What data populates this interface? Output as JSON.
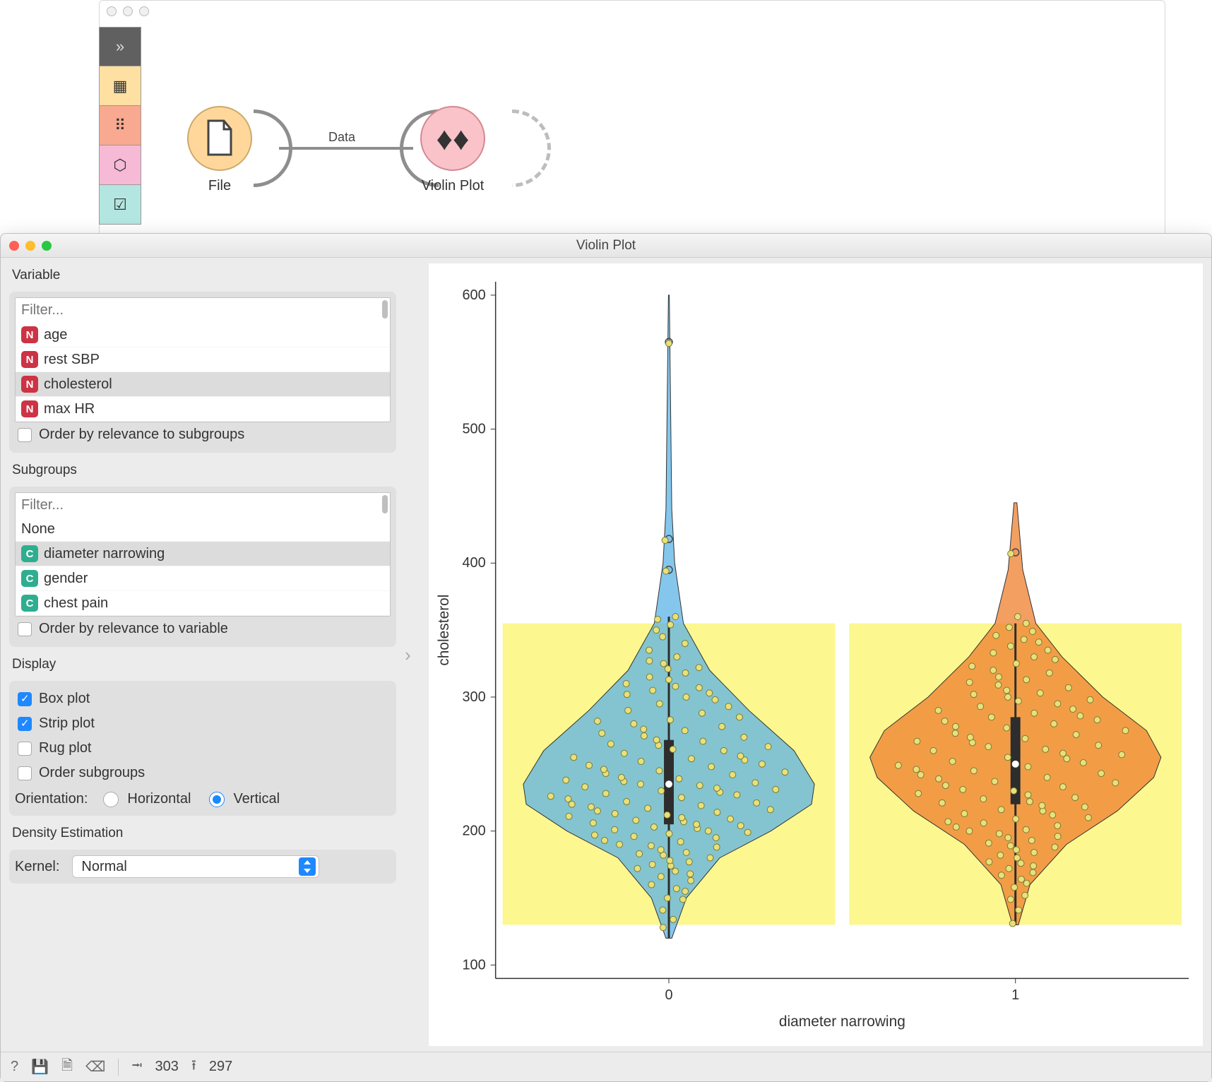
{
  "canvas": {
    "file_label": "File",
    "violin_label": "Violin Plot",
    "link_label": "Data"
  },
  "dialog": {
    "title": "Violin Plot",
    "variable_header": "Variable",
    "filter_placeholder": "Filter...",
    "variables": [
      {
        "badge": "N",
        "name": "age",
        "selected": false
      },
      {
        "badge": "N",
        "name": "rest SBP",
        "selected": false
      },
      {
        "badge": "N",
        "name": "cholesterol",
        "selected": true
      },
      {
        "badge": "N",
        "name": "max HR",
        "selected": false
      }
    ],
    "var_order_label": "Order by relevance to subgroups",
    "var_order_checked": false,
    "subgroups_header": "Subgroups",
    "subgroups": [
      {
        "badge": "",
        "name": "None",
        "selected": false
      },
      {
        "badge": "C",
        "name": "diameter narrowing",
        "selected": true
      },
      {
        "badge": "C",
        "name": "gender",
        "selected": false
      },
      {
        "badge": "C",
        "name": "chest pain",
        "selected": false
      }
    ],
    "sub_order_label": "Order by relevance to variable",
    "sub_order_checked": false,
    "display_header": "Display",
    "display_opts": [
      {
        "label": "Box plot",
        "checked": true
      },
      {
        "label": "Strip plot",
        "checked": true
      },
      {
        "label": "Rug plot",
        "checked": false
      },
      {
        "label": "Order subgroups",
        "checked": false
      }
    ],
    "orientation_label": "Orientation:",
    "orient_horizontal": "Horizontal",
    "orient_vertical": "Vertical",
    "orient_value": "Vertical",
    "density_header": "Density Estimation",
    "kernel_label": "Kernel:",
    "kernel_value": "Normal"
  },
  "status": {
    "in_count": "303",
    "out_count": "297"
  },
  "chart_data": {
    "type": "violin",
    "xlabel": "diameter narrowing",
    "ylabel": "cholesterol",
    "ytick": [
      100,
      200,
      300,
      400,
      500,
      600
    ],
    "ylim": [
      90,
      610
    ],
    "categories": [
      "0",
      "1"
    ],
    "selection_band": [
      130,
      355
    ],
    "series": [
      {
        "name": "0",
        "color": "#5cb3e6",
        "median": 235,
        "q1": 205,
        "q3": 268,
        "whisker_low": 120,
        "whisker_high": 360,
        "outliers": [
          395,
          418,
          565
        ],
        "violin_widths": [
          [
            120,
            0.02
          ],
          [
            150,
            0.12
          ],
          [
            180,
            0.35
          ],
          [
            200,
            0.7
          ],
          [
            220,
            0.98
          ],
          [
            235,
            1.0
          ],
          [
            260,
            0.86
          ],
          [
            290,
            0.55
          ],
          [
            320,
            0.28
          ],
          [
            355,
            0.1
          ],
          [
            400,
            0.04
          ],
          [
            440,
            0.02
          ],
          [
            600,
            0.003
          ]
        ]
      },
      {
        "name": "1",
        "color": "#ef7f2e",
        "median": 250,
        "q1": 220,
        "q3": 285,
        "whisker_low": 130,
        "whisker_high": 355,
        "outliers": [
          408
        ],
        "violin_widths": [
          [
            130,
            0.02
          ],
          [
            160,
            0.1
          ],
          [
            190,
            0.35
          ],
          [
            215,
            0.7
          ],
          [
            240,
            0.95
          ],
          [
            255,
            1.0
          ],
          [
            275,
            0.9
          ],
          [
            300,
            0.6
          ],
          [
            330,
            0.32
          ],
          [
            355,
            0.14
          ],
          [
            395,
            0.05
          ],
          [
            445,
            0.01
          ]
        ]
      }
    ],
    "strip_points": {
      "0": [
        128,
        134,
        141,
        149,
        150,
        155,
        157,
        160,
        163,
        166,
        168,
        170,
        172,
        174,
        175,
        177,
        178,
        180,
        182,
        183,
        184,
        186,
        188,
        189,
        190,
        192,
        193,
        195,
        196,
        197,
        198,
        199,
        200,
        201,
        202,
        203,
        204,
        205,
        206,
        207,
        208,
        209,
        210,
        211,
        212,
        213,
        214,
        215,
        216,
        217,
        218,
        219,
        220,
        221,
        222,
        224,
        225,
        226,
        227,
        228,
        229,
        230,
        231,
        232,
        233,
        234,
        235,
        236,
        237,
        238,
        239,
        240,
        242,
        243,
        244,
        245,
        246,
        248,
        249,
        250,
        252,
        253,
        254,
        255,
        256,
        258,
        260,
        261,
        263,
        264,
        265,
        267,
        268,
        270,
        271,
        273,
        275,
        276,
        278,
        280,
        282,
        283,
        285,
        288,
        290,
        293,
        295,
        298,
        300,
        302,
        303,
        305,
        307,
        308,
        310,
        313,
        315,
        318,
        321,
        322,
        325,
        327,
        330,
        335,
        340,
        345,
        350,
        354,
        358,
        360,
        394,
        417,
        564
      ],
      "1": [
        131,
        141,
        149,
        152,
        158,
        161,
        164,
        167,
        169,
        172,
        174,
        176,
        177,
        180,
        182,
        184,
        186,
        188,
        189,
        191,
        193,
        195,
        196,
        198,
        200,
        201,
        203,
        204,
        206,
        207,
        209,
        210,
        212,
        213,
        215,
        216,
        218,
        219,
        221,
        222,
        224,
        225,
        227,
        228,
        230,
        231,
        233,
        234,
        236,
        237,
        239,
        240,
        242,
        243,
        245,
        246,
        248,
        249,
        251,
        252,
        254,
        255,
        257,
        258,
        260,
        261,
        263,
        264,
        266,
        267,
        269,
        270,
        272,
        273,
        275,
        277,
        278,
        280,
        282,
        283,
        285,
        286,
        288,
        290,
        291,
        293,
        295,
        297,
        298,
        300,
        302,
        303,
        305,
        307,
        309,
        311,
        313,
        315,
        318,
        320,
        323,
        325,
        328,
        330,
        333,
        335,
        338,
        341,
        343,
        346,
        349,
        352,
        355,
        360,
        407
      ]
    }
  }
}
